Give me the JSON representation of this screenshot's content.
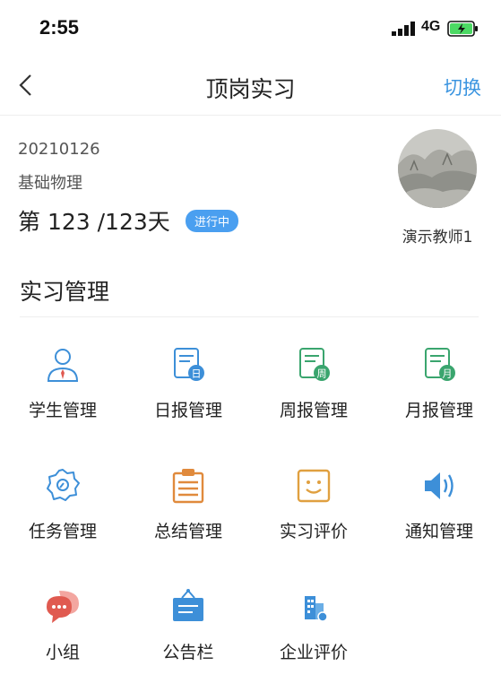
{
  "status_bar": {
    "time": "2:55",
    "network": "4G"
  },
  "nav": {
    "title": "顶岗实习",
    "switch_label": "切换"
  },
  "info": {
    "student_id": "20210126",
    "course": "基础物理",
    "day_progress": "第 123 /123天",
    "status_badge": "进行中",
    "teacher_name": "演示教师1"
  },
  "section": {
    "title": "实习管理"
  },
  "menu": [
    {
      "label": "学生管理",
      "icon": "student-icon",
      "color": "#3d8fd8"
    },
    {
      "label": "日报管理",
      "icon": "daily-report-icon",
      "color": "#3d8fd8"
    },
    {
      "label": "周报管理",
      "icon": "weekly-report-icon",
      "color": "#3aa56e"
    },
    {
      "label": "月报管理",
      "icon": "monthly-report-icon",
      "color": "#3aa56e"
    },
    {
      "label": "任务管理",
      "icon": "task-gear-icon",
      "color": "#3d8fd8"
    },
    {
      "label": "总结管理",
      "icon": "summary-clipboard-icon",
      "color": "#e08a3c"
    },
    {
      "label": "实习评价",
      "icon": "smile-evaluation-icon",
      "color": "#e0a040"
    },
    {
      "label": "通知管理",
      "icon": "speaker-notice-icon",
      "color": "#3d8fd8"
    },
    {
      "label": "小组",
      "icon": "chat-group-icon",
      "color": "#e05a50"
    },
    {
      "label": "公告栏",
      "icon": "bulletin-board-icon",
      "color": "#3d8fd8"
    },
    {
      "label": "企业评价",
      "icon": "enterprise-building-icon",
      "color": "#3d8fd8"
    }
  ],
  "colors": {
    "accent": "#3c95e0",
    "badge": "#4a9ff0"
  }
}
